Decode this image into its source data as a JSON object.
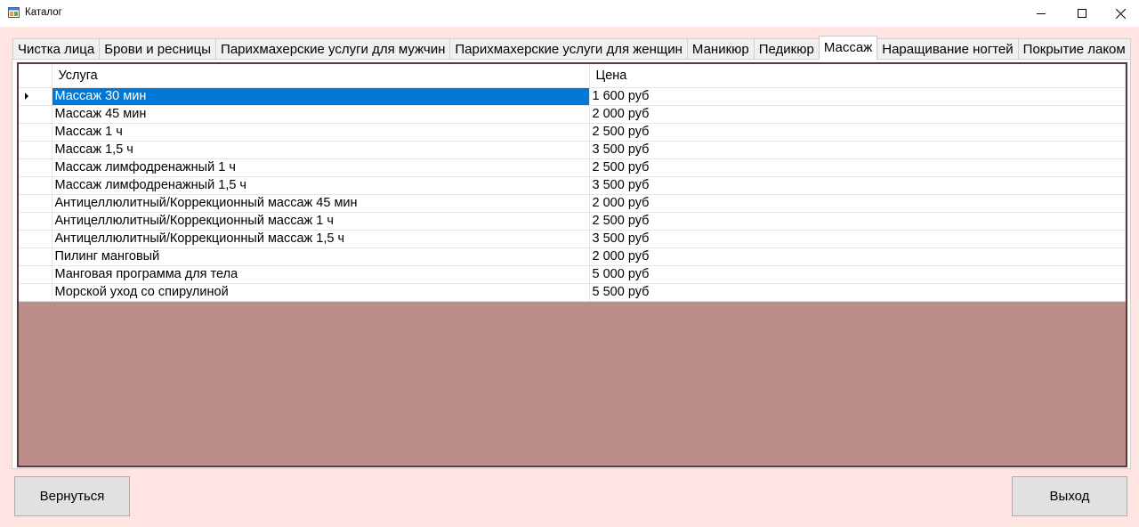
{
  "window": {
    "title": "Каталог",
    "minimize_glyph": "—",
    "maximize_glyph": "☐",
    "close_glyph": "✕"
  },
  "tabs": [
    {
      "label": "Чистка лица",
      "active": false
    },
    {
      "label": "Брови и ресницы",
      "active": false
    },
    {
      "label": "Парихмахерские услуги для мужчин",
      "active": false
    },
    {
      "label": "Парихмахерские услуги для женщин",
      "active": false
    },
    {
      "label": "Маникюр",
      "active": false
    },
    {
      "label": "Педикюр",
      "active": false
    },
    {
      "label": "Массаж",
      "active": true
    },
    {
      "label": "Наращивание ногтей",
      "active": false
    },
    {
      "label": "Покрытие лаком",
      "active": false
    }
  ],
  "grid": {
    "columns": [
      "Услуга",
      "Цена"
    ],
    "selected_row": 0,
    "rows": [
      [
        "Массаж 30 мин",
        "1 600 руб"
      ],
      [
        "Массаж 45 мин",
        "2 000 руб"
      ],
      [
        "Массаж 1 ч",
        "2 500 руб"
      ],
      [
        "Массаж 1,5 ч",
        "3 500 руб"
      ],
      [
        "Массаж лимфодренажный 1 ч",
        "2 500 руб"
      ],
      [
        "Массаж лимфодренажный 1,5 ч",
        "3 500 руб"
      ],
      [
        "Антицеллюлитный/Коррекционный массаж 45 мин",
        "2 000 руб"
      ],
      [
        "Антицеллюлитный/Коррекционный массаж 1 ч",
        "2 500 руб"
      ],
      [
        "Антицеллюлитный/Коррекционный массаж 1,5 ч",
        "3 500 руб"
      ],
      [
        "Пилинг манговый",
        "2 000 руб"
      ],
      [
        "Манговая программа для тела",
        "5 000 руб"
      ],
      [
        "Морской уход со спирулиной",
        "5 500 руб"
      ]
    ]
  },
  "buttons": {
    "back_label": "Вернуться",
    "exit_label": "Выход"
  },
  "colors": {
    "form_background": "#ffe4e1",
    "grid_background": "#bb8e8c",
    "selection": "#0078d7"
  }
}
